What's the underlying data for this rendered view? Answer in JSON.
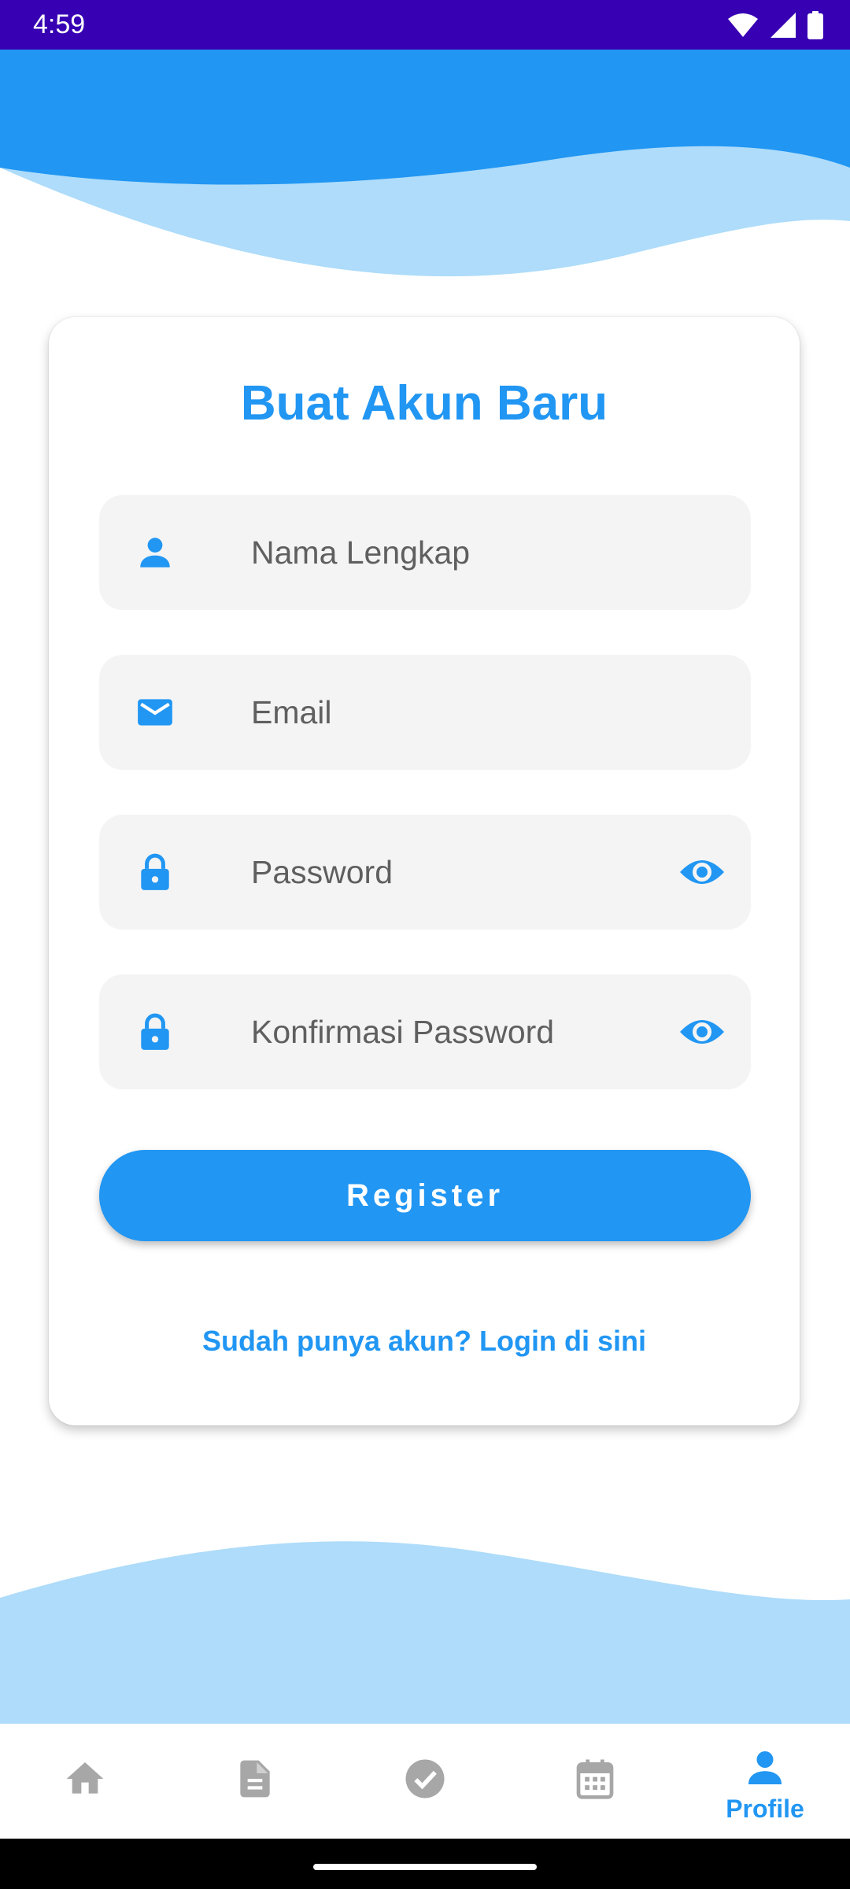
{
  "status_bar": {
    "time": "4:59"
  },
  "card": {
    "title": "Buat Akun Baru",
    "fields": [
      {
        "placeholder": "Nama Lengkap",
        "icon": "person-icon"
      },
      {
        "placeholder": "Email",
        "icon": "mail-icon"
      },
      {
        "placeholder": "Password",
        "icon": "lock-icon",
        "trailing_icon": "visibility-icon"
      },
      {
        "placeholder": "Konfirmasi Password",
        "icon": "lock-icon",
        "trailing_icon": "visibility-icon"
      }
    ],
    "register_label": "Register",
    "login_link": "Sudah punya akun? Login di sini"
  },
  "bottom_nav": {
    "items": [
      {
        "icon": "home-icon",
        "label": ""
      },
      {
        "icon": "document-icon",
        "label": ""
      },
      {
        "icon": "check-circle-icon",
        "label": ""
      },
      {
        "icon": "calendar-icon",
        "label": ""
      },
      {
        "icon": "person-icon",
        "label": "Profile",
        "active": true
      }
    ]
  },
  "colors": {
    "primary": "#2196f3",
    "status_bar": "#3700b3",
    "wave_light": "#aedcfa",
    "field_bg": "#f4f4f4",
    "inactive_icon": "#a7a7a7"
  }
}
